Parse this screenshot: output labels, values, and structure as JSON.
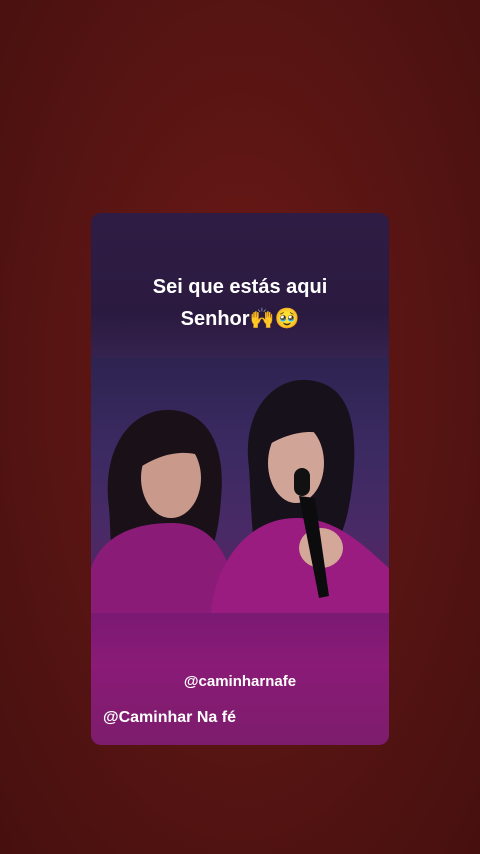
{
  "overlay": {
    "caption_line1": "Sei que estás aqui",
    "caption_line2": "Senhor🙌🥹",
    "handle": "@caminharnafe",
    "watermark": "@Caminhar Na fé"
  },
  "colors": {
    "background": "#5a1513",
    "card_top": "#2f1c44",
    "outfit_magenta": "#8a1b77"
  }
}
